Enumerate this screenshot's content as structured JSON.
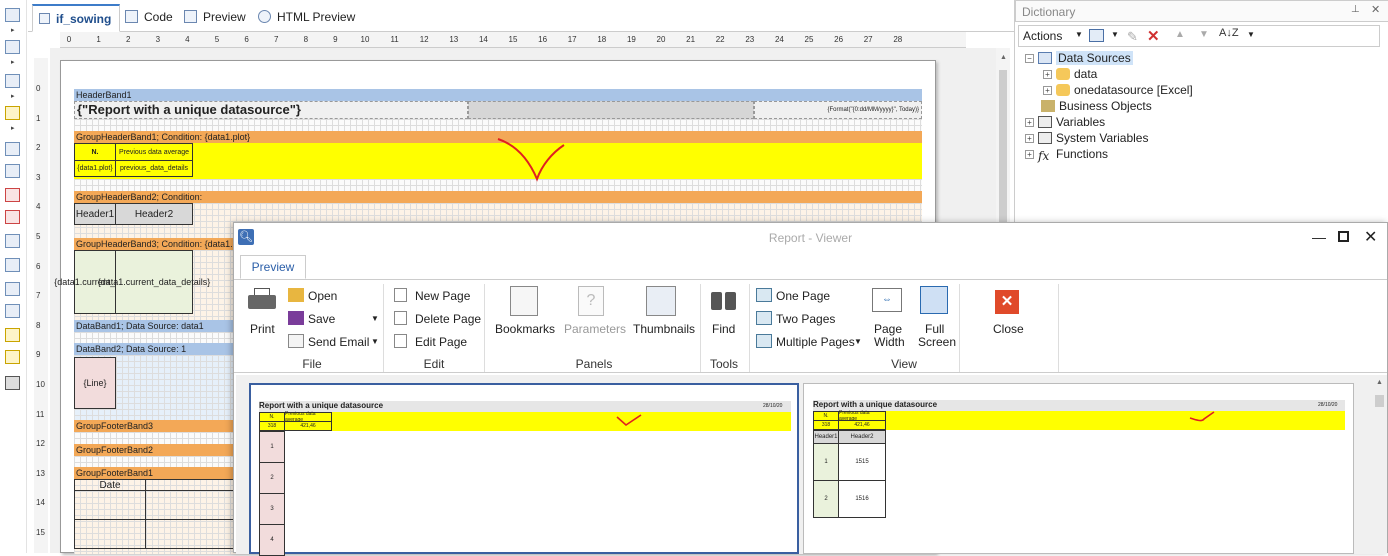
{
  "designer": {
    "tabs": [
      {
        "label": "if_sowing"
      },
      {
        "label": "Code"
      },
      {
        "label": "Preview"
      },
      {
        "label": "HTML Preview"
      }
    ],
    "ruler_ticks": [
      "0",
      "1",
      "2",
      "3",
      "4",
      "5",
      "6",
      "7",
      "8",
      "9",
      "10",
      "11",
      "12",
      "13",
      "14",
      "15",
      "16",
      "17",
      "18",
      "19",
      "20",
      "21",
      "22",
      "23",
      "24",
      "25",
      "26",
      "27",
      "28"
    ],
    "vruler_ticks": [
      "0",
      "1",
      "2",
      "3",
      "4",
      "5",
      "6",
      "7",
      "8",
      "9",
      "10",
      "11",
      "12",
      "13",
      "14",
      "15"
    ],
    "bands": {
      "header": "HeaderBand1",
      "report_title": "{\"Report with a unique datasource\"}",
      "date_expr": "{Format(\"{0:dd/MM/yyyy}\", Today)}",
      "group1": "GroupHeaderBand1; Condition: {data1.plot}",
      "n_label": "N.",
      "prev_avg": "Previous data average",
      "data1_plot": "{data1.plot}",
      "prev_details": "previous_data_details",
      "group2": "GroupHeaderBand2; Condition:",
      "header1": "Header1",
      "header2": "Header2",
      "group3": "GroupHeaderBand3; Condition: {data1.c",
      "cur_data": "{data1.current_data}",
      "cur_details": "{data1.current_data_details}",
      "databand1": "DataBand1; Data Source: data1",
      "databand2": "DataBand2; Data Source: 1",
      "line": "{Line}",
      "gfooter3": "GroupFooterBand3",
      "gfooter2": "GroupFooterBand2",
      "gfooter1": "GroupFooterBand1",
      "date": "Date"
    }
  },
  "dictionary": {
    "title": "Dictionary",
    "actions": "Actions",
    "tree": [
      {
        "label": "Data Sources"
      },
      {
        "label": "data"
      },
      {
        "label": "onedatasource [Excel]"
      },
      {
        "label": "Business Objects"
      },
      {
        "label": "Variables"
      },
      {
        "label": "System Variables"
      },
      {
        "label": "Functions"
      }
    ]
  },
  "viewer": {
    "title": "Report - Viewer",
    "tab": "Preview",
    "file": {
      "print": "Print",
      "open": "Open",
      "save": "Save",
      "send_email": "Send Email",
      "group": "File"
    },
    "edit": {
      "new_page": "New Page",
      "delete_page": "Delete Page",
      "edit_page": "Edit Page",
      "group": "Edit"
    },
    "panels": {
      "bookmarks": "Bookmarks",
      "parameters": "Parameters",
      "thumbnails": "Thumbnails",
      "group": "Panels"
    },
    "tools": {
      "find": "Find",
      "group": "Tools"
    },
    "view": {
      "one_page": "One Page",
      "two_pages": "Two Pages",
      "multiple_pages": "Multiple Pages",
      "page_width_1": "Page",
      "page_width_2": "Width",
      "full_screen_1": "Full",
      "full_screen_2": "Screen",
      "group": "View"
    },
    "close": "Close",
    "pages": [
      {
        "title": "Report with a unique datasource",
        "date": "28/10/20",
        "n_label": "N.",
        "prev_avg": "Previous data average",
        "row_a": "318",
        "row_b": "421,46",
        "rows": [
          "1",
          "2",
          "3",
          "4"
        ]
      },
      {
        "title": "Report with a unique datasource",
        "date": "28/10/20",
        "n_label": "N.",
        "prev_avg": "Previous data average",
        "row_a": "318",
        "row_b": "421,46",
        "header1": "Header1",
        "header2": "Header2",
        "rows": [
          {
            "n": "1",
            "v": "1515"
          },
          {
            "n": "2",
            "v": "1516"
          }
        ]
      }
    ]
  }
}
